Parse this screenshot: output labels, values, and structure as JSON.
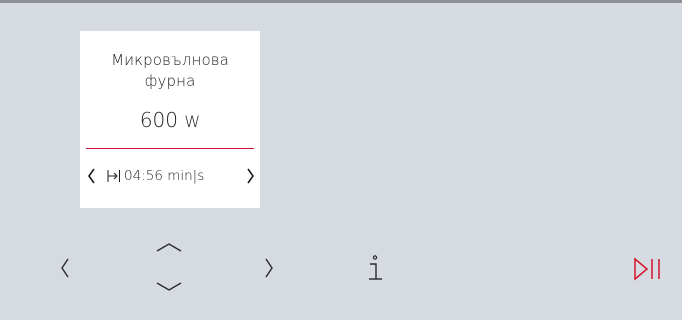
{
  "program": {
    "mode_line1": "Микровълнова",
    "mode_line2": "фурна",
    "power_value": "600",
    "power_unit": "W",
    "duration_value": "04:56",
    "duration_unit": "min|s",
    "duration_icon": "timer-end-icon"
  },
  "controls": {
    "left_icon": "chevron-left-icon",
    "up_icon": "chevron-up-icon",
    "down_icon": "chevron-down-icon",
    "right_icon": "chevron-right-icon",
    "info_icon": "info-icon",
    "start_pause_icon": "start-pause-icon"
  },
  "colors": {
    "background": "#d6dae1",
    "card": "#ffffff",
    "accent": "#d4162a"
  }
}
